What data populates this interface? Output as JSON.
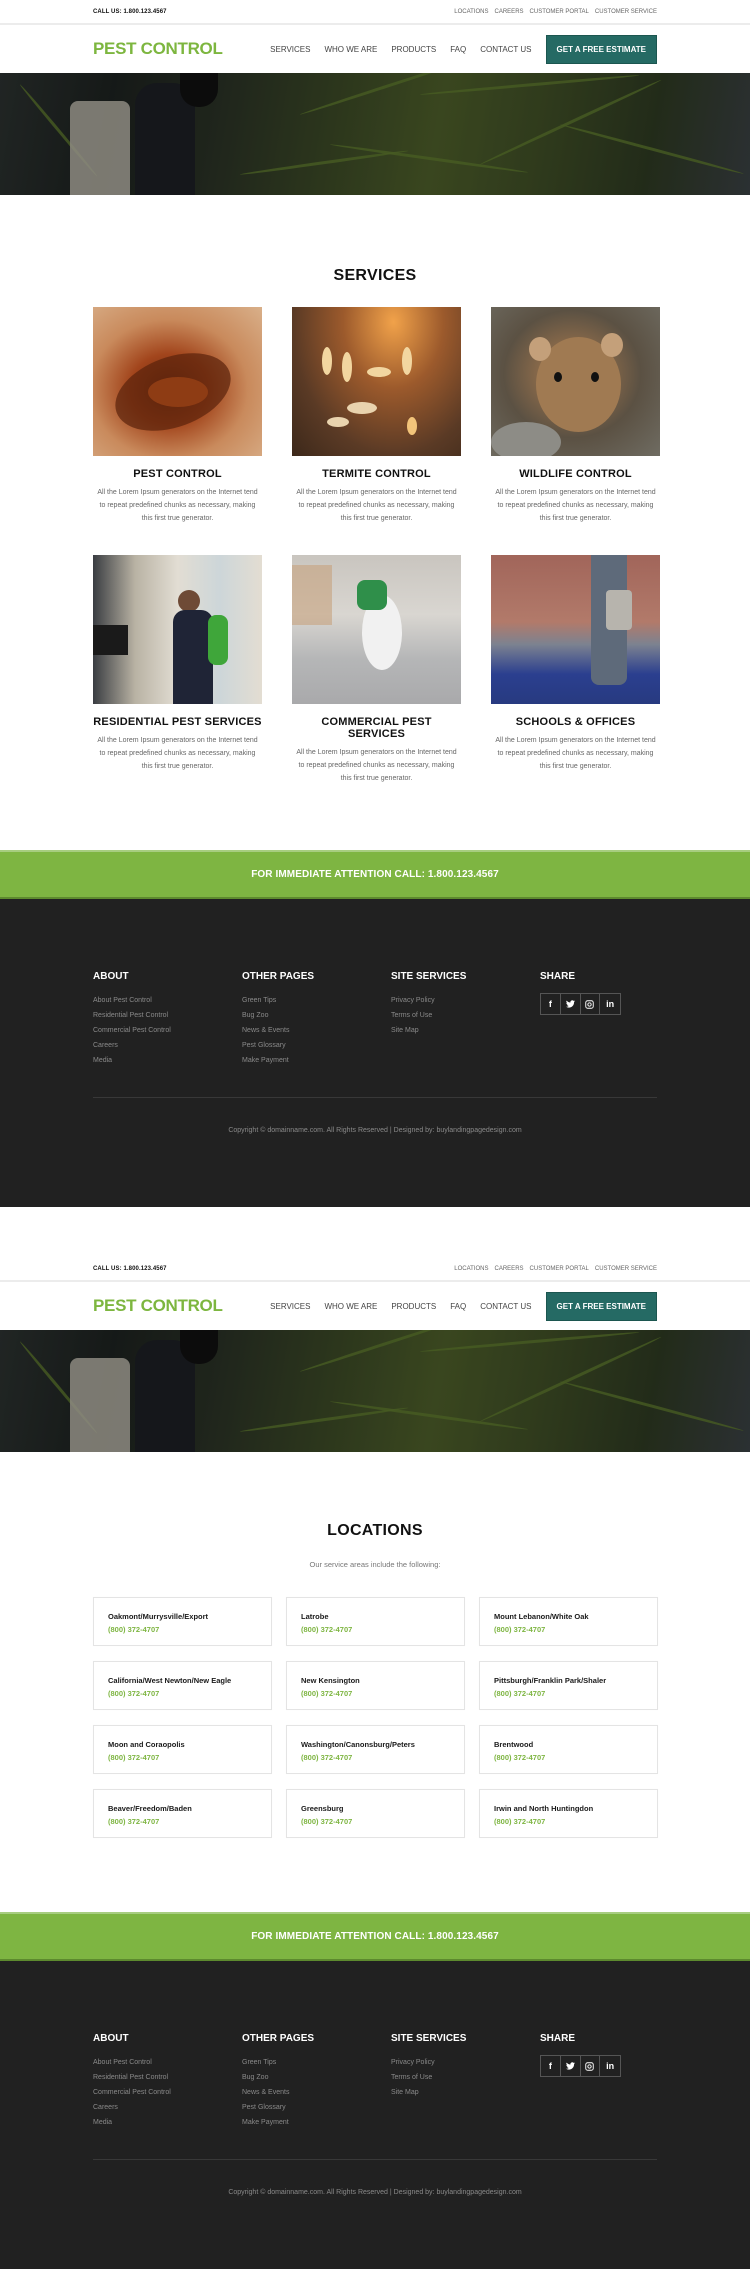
{
  "colors": {
    "brand_green": "#7eb542",
    "button_teal": "#256a64",
    "footer_bg": "#212121"
  },
  "topbar": {
    "call_us": "CALL US: 1.800.123.4567",
    "links": [
      "LOCATIONS",
      "CAREERS",
      "CUSTOMER PORTAL",
      "CUSTOMER SERVICE"
    ]
  },
  "header": {
    "logo": "PEST CONTROL",
    "nav": [
      "SERVICES",
      "WHO WE ARE",
      "PRODUCTS",
      "FAQ",
      "CONTACT US"
    ],
    "cta_button": "GET A FREE ESTIMATE"
  },
  "services": {
    "title": "SERVICES",
    "items": [
      {
        "title": "PEST CONTROL",
        "image": "cockroaches-photo",
        "desc": "All the Lorem Ipsum generators on the Internet tend to repeat predefined chunks as necessary, making this first true generator."
      },
      {
        "title": "TERMITE CONTROL",
        "image": "termites-photo",
        "desc": "All the Lorem Ipsum generators on the Internet tend to repeat predefined chunks as necessary, making this first true generator."
      },
      {
        "title": "WILDLIFE CONTROL",
        "image": "mouse-photo",
        "desc": "All the Lorem Ipsum generators on the Internet tend to repeat predefined chunks as necessary, making this first true generator."
      },
      {
        "title": "RESIDENTIAL PEST SERVICES",
        "image": "residential-spraying-photo",
        "desc": "All the Lorem Ipsum generators on the Internet tend to repeat predefined chunks as necessary, making this first true generator."
      },
      {
        "title": "COMMERCIAL PEST SERVICES",
        "image": "warehouse-spraying-photo",
        "desc": "All the Lorem Ipsum generators on the Internet tend to repeat predefined chunks as necessary, making this first true generator."
      },
      {
        "title": "SCHOOLS & OFFICES",
        "image": "outdoor-spraying-photo",
        "desc": "All the Lorem Ipsum generators on the Internet tend to repeat predefined chunks as necessary, making this first true generator."
      }
    ]
  },
  "cta_banner": {
    "text": "FOR IMMEDIATE ATTENTION CALL: 1.800.123.4567"
  },
  "footer": {
    "columns": [
      {
        "heading": "ABOUT",
        "links": [
          "About Pest Control",
          "Residential Pest Control",
          "Commercial Pest Control",
          "Careers",
          "Media"
        ]
      },
      {
        "heading": "OTHER PAGES",
        "links": [
          "Green Tips",
          "Bug Zoo",
          "News & Events",
          "Pest Glossary",
          "Make Payment"
        ]
      },
      {
        "heading": "SITE SERVICES",
        "links": [
          "Privacy Policy",
          "Terms of Use",
          "Site Map"
        ]
      }
    ],
    "share": {
      "heading": "SHARE",
      "icons": [
        {
          "name": "facebook-icon",
          "glyph": "f"
        },
        {
          "name": "twitter-icon",
          "glyph": "🐦"
        },
        {
          "name": "instagram-icon",
          "glyph": "◎"
        },
        {
          "name": "linkedin-icon",
          "glyph": "in"
        }
      ]
    },
    "copyright": "Copyright © domainname.com. All Rights Reserved  |  Designed by: buylandingpagedesign.com"
  },
  "locations": {
    "title": "LOCATIONS",
    "subtitle": "Our service areas include the following:",
    "items": [
      {
        "name": "Oakmont/Murrysville/Export",
        "phone": "(800) 372-4707"
      },
      {
        "name": "Latrobe",
        "phone": "(800) 372-4707"
      },
      {
        "name": "Mount Lebanon/White Oak",
        "phone": "(800) 372-4707"
      },
      {
        "name": "California/West Newton/New Eagle",
        "phone": "(800) 372-4707"
      },
      {
        "name": "New Kensington",
        "phone": "(800) 372-4707"
      },
      {
        "name": "Pittsburgh/Franklin Park/Shaler",
        "phone": "(800) 372-4707"
      },
      {
        "name": "Moon and Coraopolis",
        "phone": "(800) 372-4707"
      },
      {
        "name": "Washington/Canonsburg/Peters",
        "phone": "(800) 372-4707"
      },
      {
        "name": "Brentwood",
        "phone": "(800) 372-4707"
      },
      {
        "name": "Beaver/Freedom/Baden",
        "phone": "(800) 372-4707"
      },
      {
        "name": "Greensburg",
        "phone": "(800) 372-4707"
      },
      {
        "name": "Irwin and North Huntingdon",
        "phone": "(800) 372-4707"
      }
    ]
  }
}
